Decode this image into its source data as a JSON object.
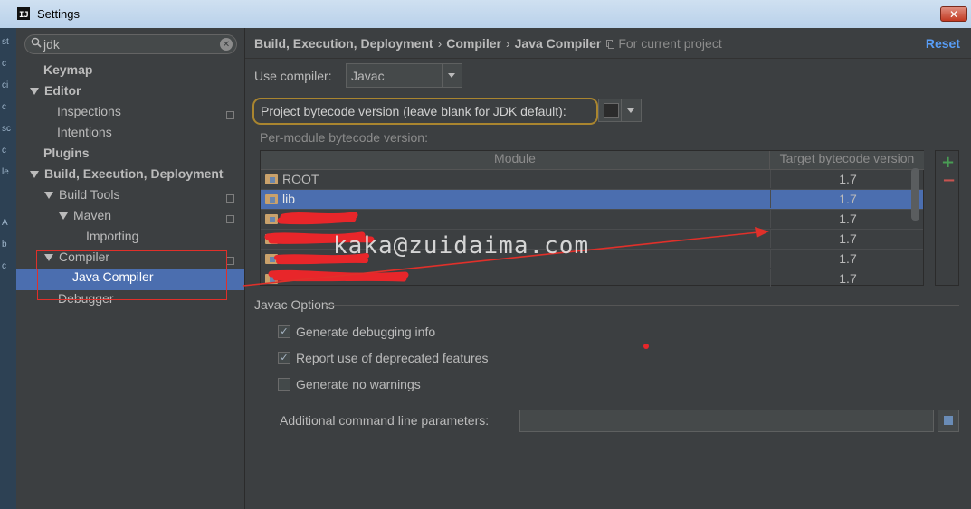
{
  "window": {
    "title": "Settings",
    "close_label": "✕"
  },
  "left_strip": [
    "st",
    "c",
    "ci",
    "c",
    "sc",
    "c",
    "le",
    "A",
    "b",
    "c"
  ],
  "search": {
    "value": "jdk"
  },
  "tree": [
    {
      "label": "Keymap",
      "bold": true
    },
    {
      "label": "Editor",
      "bold": true,
      "expanded": true
    },
    {
      "label": "Inspections",
      "copy": true
    },
    {
      "label": "Intentions"
    },
    {
      "label": "Plugins",
      "bold": true
    },
    {
      "label": "Build, Execution, Deployment",
      "bold": true,
      "expanded": true
    },
    {
      "label": "Build Tools",
      "expanded": true,
      "copy": true
    },
    {
      "label": "Maven",
      "expanded": true,
      "copy": true
    },
    {
      "label": "Importing"
    },
    {
      "label": "Compiler",
      "expanded": true,
      "copy": true
    },
    {
      "label": "Java Compiler",
      "selected": true
    },
    {
      "label": "Debugger"
    }
  ],
  "breadcrumb": {
    "parts": [
      "Build, Execution, Deployment",
      "Compiler",
      "Java Compiler"
    ],
    "separator": "›",
    "scope": "For current project"
  },
  "reset_label": "Reset",
  "use_compiler": {
    "label": "Use compiler:",
    "value": "Javac"
  },
  "project_bytecode": {
    "label": "Project bytecode version (leave blank for JDK default):"
  },
  "per_module": {
    "label": "Per-module bytecode version:",
    "columns": [
      "Module",
      "Target bytecode version"
    ],
    "rows": [
      {
        "name": "ROOT",
        "version": "1.7"
      },
      {
        "name": "lib",
        "version": "1.7",
        "selected": true
      },
      {
        "name": "",
        "version": "1.7"
      },
      {
        "name": "",
        "version": "1.7"
      },
      {
        "name": "",
        "version": "1.7"
      },
      {
        "name": "",
        "version": "1.7"
      }
    ]
  },
  "javac_options": {
    "title": "Javac Options",
    "options": [
      {
        "label": "Generate debugging info",
        "checked": true
      },
      {
        "label": "Report use of deprecated features",
        "checked": true
      },
      {
        "label": "Generate no warnings",
        "checked": false
      }
    ],
    "params_label": "Additional command line parameters:",
    "params_value": ""
  },
  "watermark": "kaka@zuidaima.com",
  "colors": {
    "accent": "#589df6",
    "selection": "#4b6eaf",
    "annotation": "#e0302a"
  }
}
